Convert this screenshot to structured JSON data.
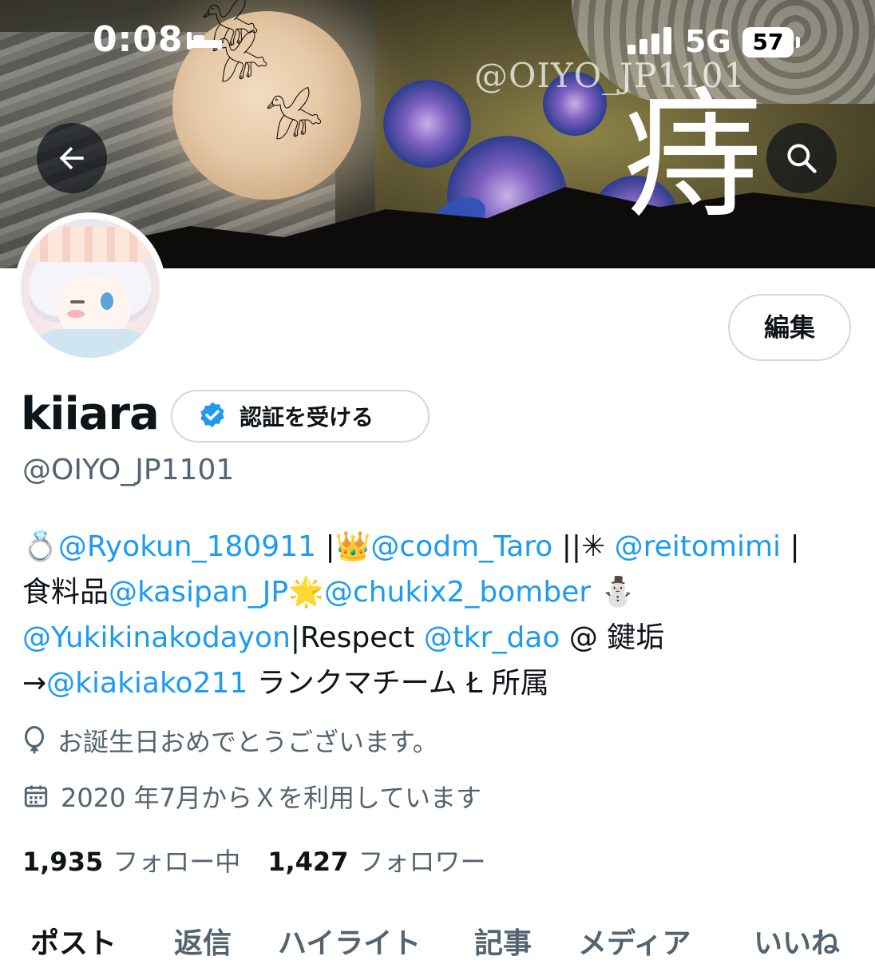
{
  "status_bar": {
    "time": "0:08",
    "network": "5G",
    "battery": "57"
  },
  "banner": {
    "watermark_handle": "@OIYO_JP1101",
    "watermark_kanji": "痔"
  },
  "icons": {
    "back": "arrow-left-icon",
    "search": "search-icon",
    "verified": "verified-badge-icon",
    "birthday": "balloon-icon",
    "joined": "calendar-icon"
  },
  "profile": {
    "edit_label": "編集",
    "display_name": "kiiara",
    "verify_label": "認証を受ける",
    "handle": "@OIYO_JP1101",
    "bio_lines": [
      [
        {
          "t": "💍",
          "m": false
        },
        {
          "t": "@Ryokun_180911",
          "m": true
        },
        {
          "t": " |👑",
          "m": false
        },
        {
          "t": "@codm_Taro",
          "m": true
        },
        {
          "t": " ||✳ ",
          "m": false
        },
        {
          "t": "@reitomimi",
          "m": true
        },
        {
          "t": " |",
          "m": false
        }
      ],
      [
        {
          "t": "食料品",
          "m": false
        },
        {
          "t": "@kasipan_JP",
          "m": true
        },
        {
          "t": "🌟",
          "m": false
        },
        {
          "t": "@chukix2_bomber",
          "m": true
        },
        {
          "t": " ⛄",
          "m": false
        }
      ],
      [
        {
          "t": "@Yukikinakodayon",
          "m": true
        },
        {
          "t": "|Respect ",
          "m": false
        },
        {
          "t": "@tkr_dao",
          "m": true
        },
        {
          "t": " @ 鍵垢",
          "m": false
        }
      ],
      [
        {
          "t": "→",
          "m": false
        },
        {
          "t": "@kiakiako211",
          "m": true
        },
        {
          "t": " ランクマチーム Ł 所属",
          "m": false
        }
      ]
    ],
    "birthday": "お誕生日おめでとうございます。",
    "joined": "2020 年7月からＸを利用しています",
    "following_count": "1,935",
    "following_label": "フォロー中",
    "followers_count": "1,427",
    "followers_label": "フォロワー"
  },
  "tabs": [
    {
      "label": "ポスト",
      "active": true
    },
    {
      "label": "返信",
      "active": false
    },
    {
      "label": "ハイライト",
      "active": false
    },
    {
      "label": "記事",
      "active": false
    },
    {
      "label": "メディア",
      "active": false
    },
    {
      "label": "いいね",
      "active": false
    }
  ],
  "colors": {
    "accent": "#1d9bf0",
    "text": "#0f1419",
    "secondary": "#536471"
  }
}
